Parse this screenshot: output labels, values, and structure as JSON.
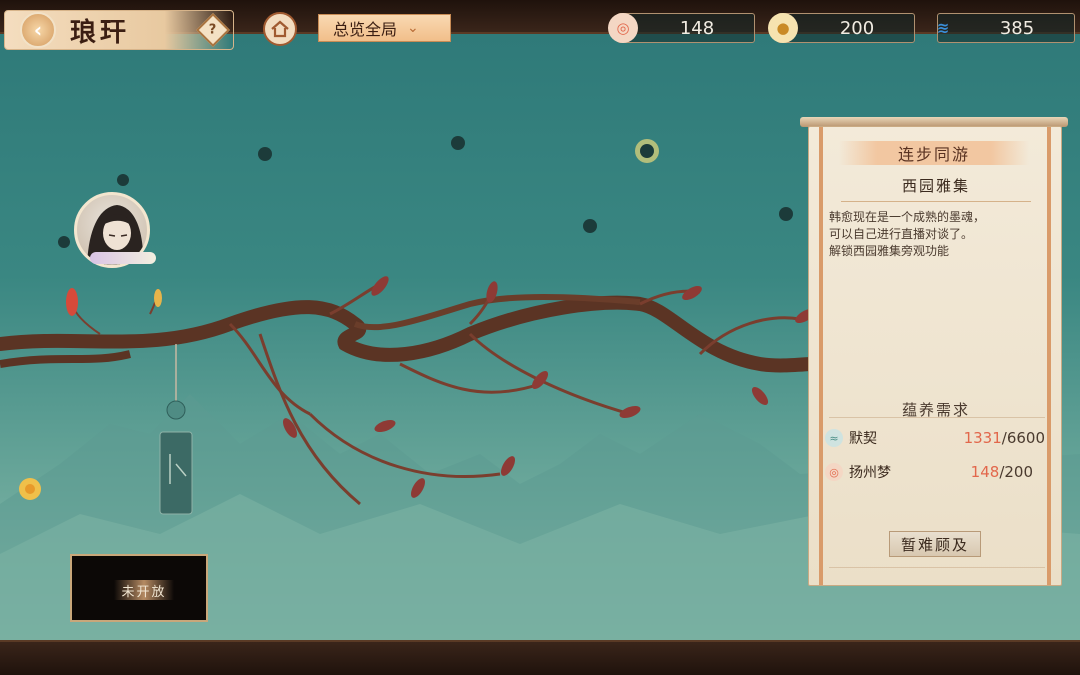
{
  "header": {
    "title": "琅玕",
    "back_icon": "back-arrow-icon",
    "help_label": "?",
    "overview_label": "总览全局",
    "resources": [
      {
        "icon": "red-swirl-icon",
        "value": "148",
        "color": "#e2674b"
      },
      {
        "icon": "gold-coin-icon",
        "value": "200",
        "color": "#e8a83a"
      },
      {
        "icon": "blue-wave-icon",
        "value": "385",
        "color": "#3a8fd9"
      }
    ]
  },
  "panel": {
    "header": "连步同游",
    "subtitle": "西园雅集",
    "description": [
      "韩愈现在是一个成熟的墨魂，",
      "可以自己进行直播对谈了。",
      "解锁西园雅集旁观功能"
    ],
    "requirement_title": "蕴养需求",
    "requirements": [
      {
        "name": "默契",
        "current": "1331",
        "max": "/6600",
        "icon": "shell-icon"
      },
      {
        "name": "扬州梦",
        "current": "148",
        "max": "/200",
        "icon": "red-swirl-icon"
      }
    ],
    "button_label": "暂难顾及"
  },
  "locked_box": {
    "label": "未开放"
  },
  "colors": {
    "accent": "#e2674b",
    "panel_bg": "#f3ead9",
    "sky_top": "#2f7a79"
  }
}
